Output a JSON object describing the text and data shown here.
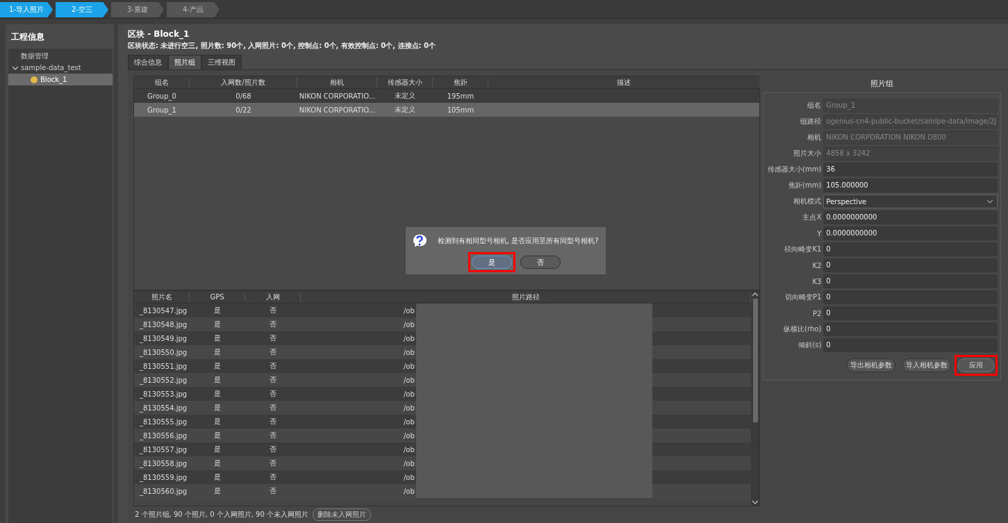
{
  "steps": [
    {
      "label": "1-导入照片",
      "done": true
    },
    {
      "label": "2-空三",
      "done": true
    },
    {
      "label": "3-重建",
      "done": false
    },
    {
      "label": "4-产品",
      "done": false
    }
  ],
  "sidebar": {
    "title": "工程信息",
    "tree": [
      {
        "label": "数据管理",
        "selected": false
      },
      {
        "label": "sample-data_test",
        "expanded": true,
        "selected": false,
        "children": [
          {
            "label": "Block_1",
            "selected": true
          }
        ]
      }
    ]
  },
  "block": {
    "title": "区块 - Block_1",
    "status": "区块状态: 未进行空三, 照片数: 90个, 入网照片: 0个, 控制点: 0个, 有效控制点: 0个, 连接点: 0个"
  },
  "tabs": [
    {
      "label": "综合信息",
      "selected": false
    },
    {
      "label": "照片组",
      "selected": true
    },
    {
      "label": "三维视图",
      "selected": false
    }
  ],
  "group_table": {
    "columns": [
      "组名",
      "入网数/照片数",
      "相机",
      "传感器大小",
      "焦距",
      "描述"
    ],
    "rows": [
      {
        "cells": [
          "Group_0",
          "0/68",
          "NIKON CORPORATIO...",
          "未定义",
          "195mm",
          ""
        ],
        "selected": false
      },
      {
        "cells": [
          "Group_1",
          "0/22",
          "NIKON CORPORATIO...",
          "未定义",
          "105mm",
          ""
        ],
        "selected": true
      }
    ]
  },
  "dialog": {
    "message": "检测到有相同型号相机, 是否应用至所有同型号相机?",
    "buttons": [
      {
        "label": "是",
        "highlighted": true
      },
      {
        "label": "否",
        "highlighted": false
      }
    ]
  },
  "photo_table": {
    "columns": [
      "照片名",
      "GPS",
      "入网",
      "照片路径"
    ],
    "rows": [
      [
        "_8130547.jpg",
        "是",
        "否",
        "/ob"
      ],
      [
        "_8130548.jpg",
        "是",
        "否",
        "/ob"
      ],
      [
        "_8130549.jpg",
        "是",
        "否",
        "/ob"
      ],
      [
        "_8130550.jpg",
        "是",
        "否",
        "/ob"
      ],
      [
        "_8130551.jpg",
        "是",
        "否",
        "/ob"
      ],
      [
        "_8130552.jpg",
        "是",
        "否",
        "/ob"
      ],
      [
        "_8130553.jpg",
        "是",
        "否",
        "/ob"
      ],
      [
        "_8130554.jpg",
        "是",
        "否",
        "/ob"
      ],
      [
        "_8130555.jpg",
        "是",
        "否",
        "/ob"
      ],
      [
        "_8130556.jpg",
        "是",
        "否",
        "/ob"
      ],
      [
        "_8130557.jpg",
        "是",
        "否",
        "/ob"
      ],
      [
        "_8130558.jpg",
        "是",
        "否",
        "/ob"
      ],
      [
        "_8130559.jpg",
        "是",
        "否",
        "/ob"
      ],
      [
        "_8130560.jpg",
        "是",
        "否",
        "/ob"
      ]
    ]
  },
  "summary": {
    "text": "2 个照片组, 90 个照片, 0 个入网照片, 90 个未入网照片",
    "button": "删除未入网照片"
  },
  "form": {
    "title": "照片组",
    "fields": [
      {
        "label": "组名",
        "value": "Group_1",
        "kind": "text",
        "disabled": true
      },
      {
        "label": "组路径",
        "value": "ogenius-cn4-public-bucket/samlpe-data/image/2J",
        "kind": "text",
        "disabled": true
      },
      {
        "label": "相机",
        "value": "NIKON CORPORATION NIKON D800",
        "kind": "text",
        "disabled": true
      },
      {
        "label": "照片大小",
        "value": "4858 x 3242",
        "kind": "text",
        "disabled": true
      },
      {
        "label": "传感器大小(mm)",
        "value": "36",
        "kind": "text",
        "disabled": false
      },
      {
        "label": "焦距(mm)",
        "value": "105.000000",
        "kind": "text",
        "disabled": false
      },
      {
        "label": "相机模式",
        "value": "Perspective",
        "kind": "select",
        "disabled": false
      },
      {
        "label": "主点X",
        "value": "0.0000000000",
        "kind": "text",
        "disabled": false
      },
      {
        "label": "Y",
        "value": "0.0000000000",
        "kind": "text",
        "disabled": false
      },
      {
        "label": "径向畸变K1",
        "value": "0",
        "kind": "text",
        "disabled": false
      },
      {
        "label": "K2",
        "value": "0",
        "kind": "text",
        "disabled": false
      },
      {
        "label": "K3",
        "value": "0",
        "kind": "text",
        "disabled": false
      },
      {
        "label": "切向畸变P1",
        "value": "0",
        "kind": "text",
        "disabled": false
      },
      {
        "label": "P2",
        "value": "0",
        "kind": "text",
        "disabled": false
      },
      {
        "label": "纵横比(rho)",
        "value": "0",
        "kind": "text",
        "disabled": false
      },
      {
        "label": "倾斜(s)",
        "value": "0",
        "kind": "text",
        "disabled": false
      }
    ],
    "buttons": [
      {
        "label": "导出相机参数",
        "highlighted": false
      },
      {
        "label": "导入相机参数",
        "highlighted": false
      },
      {
        "label": "应用",
        "highlighted": true
      }
    ]
  }
}
